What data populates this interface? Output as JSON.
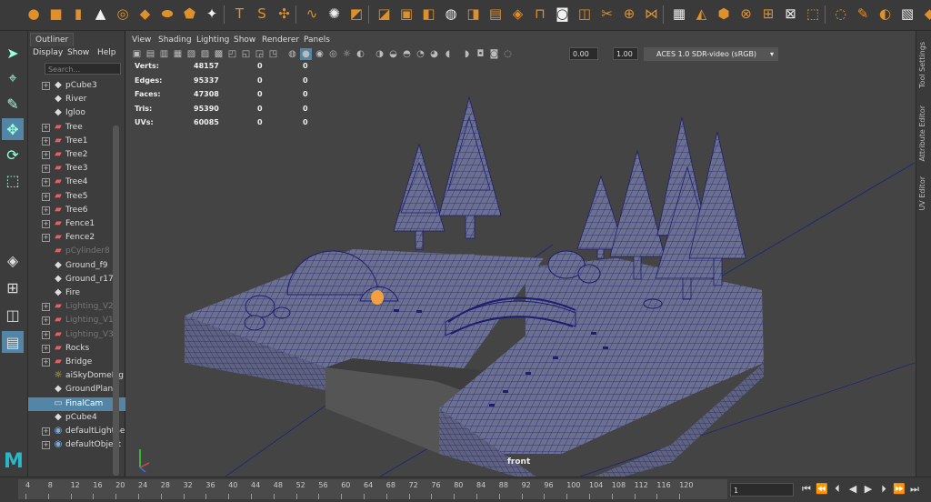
{
  "shelf": {
    "icons": [
      "sphere-icon",
      "cube-icon",
      "cylinder-icon",
      "cone-icon",
      "torus-icon",
      "plane-icon",
      "disc-icon",
      "platonic-icon",
      "superellipse-icon",
      "text-icon",
      "svg-icon",
      "pivot-icon",
      "curve-tool-icon",
      "particle-icon",
      "combine-icon",
      "separate-icon",
      "extract-icon",
      "boolean-icon",
      "smooth-icon",
      "mirror-icon",
      "extrude-icon",
      "bevel-icon",
      "bridge-icon",
      "fill-hole-icon",
      "append-icon",
      "multicut-icon",
      "target-weld-icon",
      "connect-icon",
      "quad-draw-icon",
      "wedge-icon",
      "chamfer-icon",
      "collapse-icon",
      "merge-icon",
      "delete-edge-icon",
      "select-tool-icon",
      "lasso-icon",
      "paint-icon",
      "soft-select-icon",
      "uv-icon",
      "bookmark-icon"
    ]
  },
  "toolbox": {
    "tools": [
      "select-arrow-icon",
      "lasso-tool-icon",
      "paint-select-icon",
      "move-tool-icon",
      "rotate-tool-icon",
      "scale-tool-icon"
    ]
  },
  "outliner": {
    "tab": "Outliner",
    "menu": [
      "Display",
      "Show",
      "Help"
    ],
    "search_placeholder": "Search...",
    "items": [
      {
        "label": "pCube3",
        "icon": "mesh",
        "exp": true,
        "dim": false
      },
      {
        "label": "River",
        "icon": "mesh",
        "exp": false,
        "dim": false
      },
      {
        "label": "Igloo",
        "icon": "mesh",
        "exp": false,
        "dim": false
      },
      {
        "label": "Tree",
        "icon": "group",
        "exp": true,
        "dim": false
      },
      {
        "label": "Tree1",
        "icon": "group",
        "exp": true,
        "dim": false
      },
      {
        "label": "Tree2",
        "icon": "group",
        "exp": true,
        "dim": false
      },
      {
        "label": "Tree3",
        "icon": "group",
        "exp": true,
        "dim": false
      },
      {
        "label": "Tree4",
        "icon": "group",
        "exp": true,
        "dim": false
      },
      {
        "label": "Tree5",
        "icon": "group",
        "exp": true,
        "dim": false
      },
      {
        "label": "Tree6",
        "icon": "group",
        "exp": true,
        "dim": false
      },
      {
        "label": "Fence1",
        "icon": "group",
        "exp": true,
        "dim": false
      },
      {
        "label": "Fence2",
        "icon": "group",
        "exp": true,
        "dim": false
      },
      {
        "label": "pCylinder8",
        "icon": "group",
        "exp": false,
        "dim": true
      },
      {
        "label": "Ground_f9",
        "icon": "mesh",
        "exp": false,
        "dim": false
      },
      {
        "label": "Ground_r17",
        "icon": "mesh",
        "exp": false,
        "dim": false
      },
      {
        "label": "Fire",
        "icon": "mesh",
        "exp": false,
        "dim": false
      },
      {
        "label": "Lighting_V2",
        "icon": "group",
        "exp": true,
        "dim": true
      },
      {
        "label": "Lighting_V1",
        "icon": "group",
        "exp": true,
        "dim": true
      },
      {
        "label": "Lighting_V3",
        "icon": "group",
        "exp": true,
        "dim": true
      },
      {
        "label": "Rocks",
        "icon": "group",
        "exp": true,
        "dim": false
      },
      {
        "label": "Bridge",
        "icon": "group",
        "exp": true,
        "dim": false
      },
      {
        "label": "aiSkyDomeLig",
        "icon": "light",
        "exp": false,
        "dim": false
      },
      {
        "label": "GroundPlane",
        "icon": "mesh",
        "exp": false,
        "dim": false
      },
      {
        "label": "FinalCam",
        "icon": "camera",
        "exp": false,
        "dim": false,
        "selected": true
      },
      {
        "label": "pCube4",
        "icon": "mesh",
        "exp": false,
        "dim": false
      },
      {
        "label": "defaultLightSe",
        "icon": "set",
        "exp": true,
        "dim": false
      },
      {
        "label": "defaultObject",
        "icon": "set",
        "exp": true,
        "dim": false
      }
    ]
  },
  "viewport": {
    "menu": [
      "View",
      "Shading",
      "Lighting",
      "Show",
      "Renderer",
      "Panels"
    ],
    "exposure": "0.00",
    "gamma": "1.00",
    "colorspace": "ACES 1.0 SDR-video (sRGB)",
    "camera_label": "front",
    "hud": [
      {
        "label": "Verts:",
        "a": "48157",
        "b": "0",
        "c": "0"
      },
      {
        "label": "Edges:",
        "a": "95337",
        "b": "0",
        "c": "0"
      },
      {
        "label": "Faces:",
        "a": "47308",
        "b": "0",
        "c": "0"
      },
      {
        "label": "Tris:",
        "a": "95390",
        "b": "0",
        "c": "0"
      },
      {
        "label": "UVs:",
        "a": "60085",
        "b": "0",
        "c": "0"
      }
    ]
  },
  "right_panels": [
    "Tool Settings",
    "Attribute Editor",
    "UV Editor"
  ],
  "timeline": {
    "ticks": [
      "4",
      "8",
      "12",
      "16",
      "20",
      "24",
      "28",
      "32",
      "36",
      "40",
      "44",
      "48",
      "52",
      "56",
      "60",
      "64",
      "68",
      "72",
      "76",
      "80",
      "84",
      "88",
      "92",
      "96",
      "100",
      "104",
      "108",
      "112",
      "116",
      "120"
    ],
    "current_frame": "1"
  },
  "colors": {
    "accent": "#5285a6",
    "wire": "#1e1e6e",
    "mesh": "#6b6f90",
    "maya": "#28b8c8",
    "icon": "#e0902a"
  }
}
